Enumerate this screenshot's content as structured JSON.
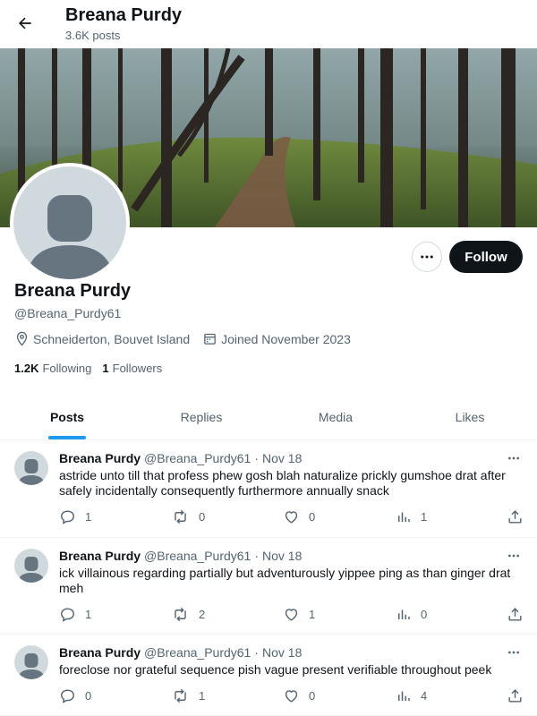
{
  "header": {
    "name": "Breana Purdy",
    "post_count": "3.6K posts"
  },
  "profile": {
    "name": "Breana Purdy",
    "handle": "@Breana_Purdy61",
    "location": "Schneiderton, Bouvet Island",
    "joined": "Joined November 2023",
    "following_count": "1.2K",
    "following_label": "Following",
    "followers_count": "1",
    "followers_label": "Followers",
    "follow_label": "Follow"
  },
  "tabs": [
    {
      "label": "Posts",
      "active": true
    },
    {
      "label": "Replies",
      "active": false
    },
    {
      "label": "Media",
      "active": false
    },
    {
      "label": "Likes",
      "active": false
    }
  ],
  "posts": [
    {
      "name": "Breana Purdy",
      "handle": "@Breana_Purdy61",
      "dot": "·",
      "date": "Nov 18",
      "text": "astride unto till that profess phew gosh blah naturalize prickly gumshoe drat after safely incidentally consequently furthermore annually snack",
      "replies": "1",
      "reposts": "0",
      "likes": "0",
      "views": "1"
    },
    {
      "name": "Breana Purdy",
      "handle": "@Breana_Purdy61",
      "dot": "·",
      "date": "Nov 18",
      "text": "ick villainous regarding partially but adventurously yippee ping as than ginger drat meh",
      "replies": "1",
      "reposts": "2",
      "likes": "1",
      "views": "0"
    },
    {
      "name": "Breana Purdy",
      "handle": "@Breana_Purdy61",
      "dot": "·",
      "date": "Nov 18",
      "text": "foreclose nor grateful sequence pish vague present verifiable throughout peek",
      "replies": "0",
      "reposts": "1",
      "likes": "0",
      "views": "4"
    }
  ],
  "icons": {
    "back": "arrow-left-icon",
    "location": "location-pin-icon",
    "calendar": "calendar-icon",
    "more": "more-dots-icon",
    "reply": "reply-icon",
    "repost": "repost-icon",
    "like": "heart-icon",
    "views": "views-icon",
    "share": "share-icon"
  },
  "colors": {
    "accent": "#1d9bf0",
    "text": "#0f1419",
    "muted": "#536471",
    "follow_bg": "#0f1419"
  }
}
